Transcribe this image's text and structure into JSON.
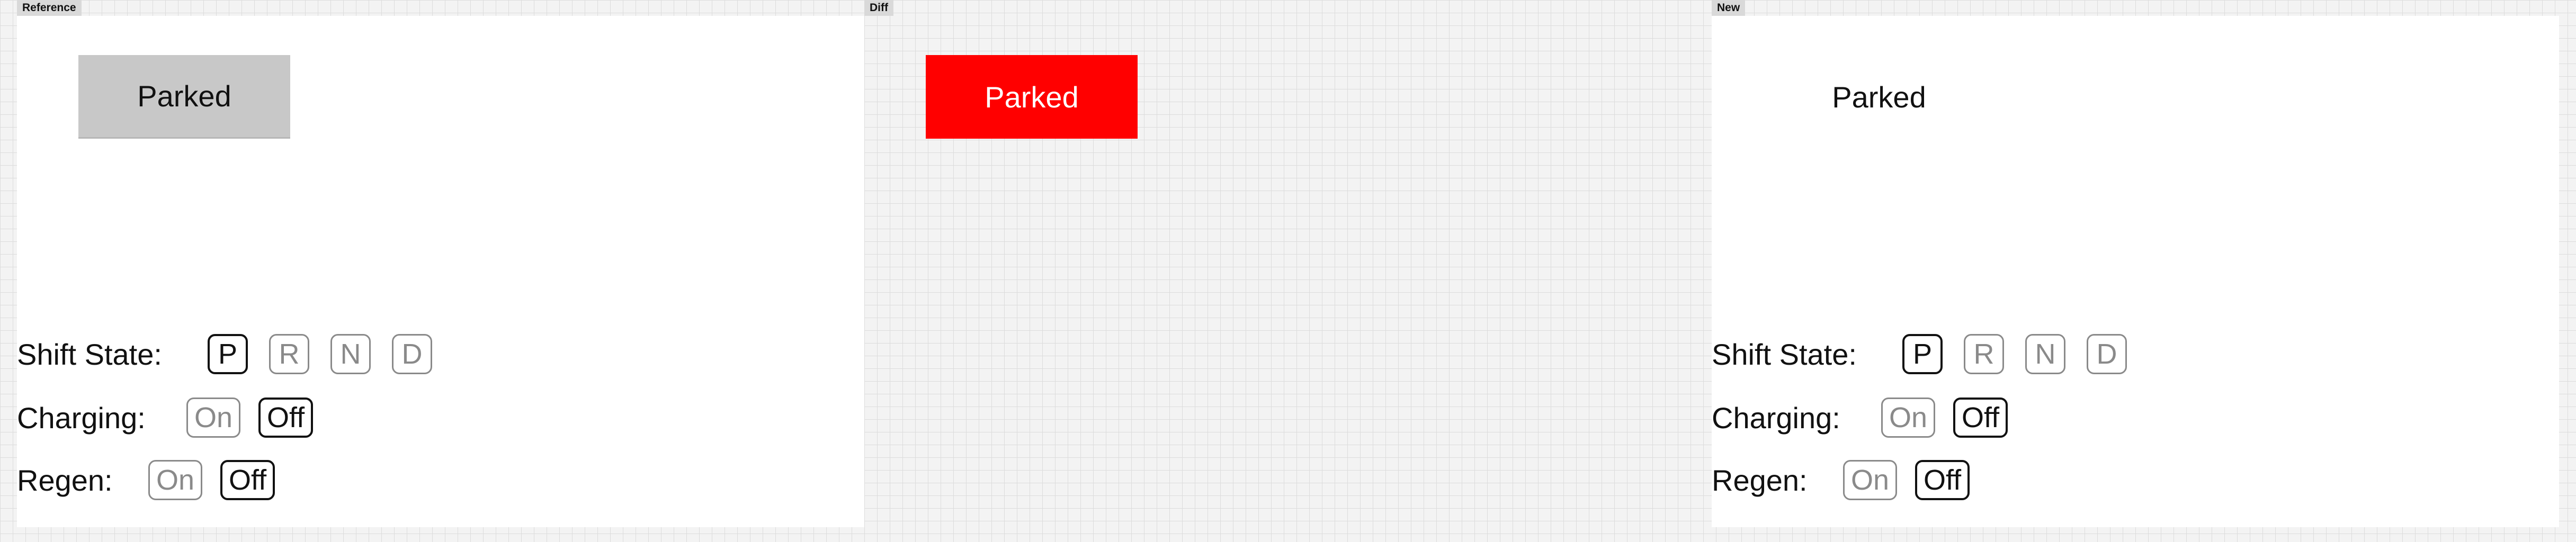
{
  "panels": {
    "reference": {
      "tag": "Reference"
    },
    "diff": {
      "tag": "Diff"
    },
    "new": {
      "tag": "New"
    }
  },
  "status": {
    "parked_label": "Parked"
  },
  "controls": {
    "shift_state": {
      "label": "Shift State:",
      "options": [
        "P",
        "R",
        "N",
        "D"
      ],
      "active": "P"
    },
    "charging": {
      "label": "Charging:",
      "options": [
        "On",
        "Off"
      ],
      "active": "Off"
    },
    "regen": {
      "label": "Regen:",
      "options": [
        "On",
        "Off"
      ],
      "active": "Off"
    }
  },
  "colors": {
    "diff_highlight": "#ff0000",
    "reference_parked_bg": "#c8c8c8",
    "active_border": "#111111",
    "inactive_border": "#8a8a8a"
  }
}
